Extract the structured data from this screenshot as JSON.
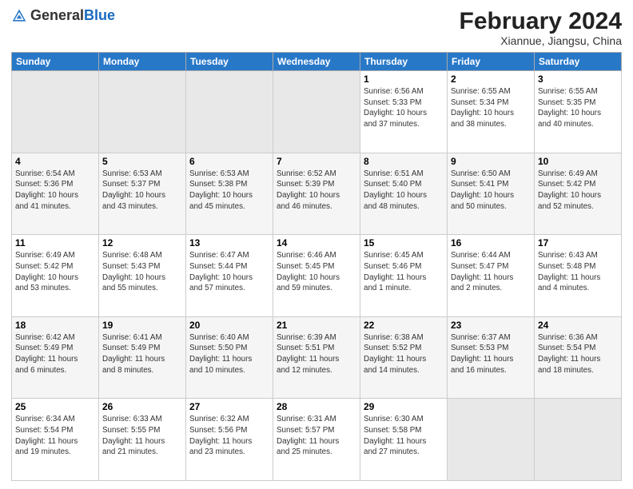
{
  "header": {
    "logo_general": "General",
    "logo_blue": "Blue",
    "month_year": "February 2024",
    "location": "Xiannue, Jiangsu, China"
  },
  "weekdays": [
    "Sunday",
    "Monday",
    "Tuesday",
    "Wednesday",
    "Thursday",
    "Friday",
    "Saturday"
  ],
  "weeks": [
    [
      {
        "day": "",
        "info": ""
      },
      {
        "day": "",
        "info": ""
      },
      {
        "day": "",
        "info": ""
      },
      {
        "day": "",
        "info": ""
      },
      {
        "day": "1",
        "info": "Sunrise: 6:56 AM\nSunset: 5:33 PM\nDaylight: 10 hours\nand 37 minutes."
      },
      {
        "day": "2",
        "info": "Sunrise: 6:55 AM\nSunset: 5:34 PM\nDaylight: 10 hours\nand 38 minutes."
      },
      {
        "day": "3",
        "info": "Sunrise: 6:55 AM\nSunset: 5:35 PM\nDaylight: 10 hours\nand 40 minutes."
      }
    ],
    [
      {
        "day": "4",
        "info": "Sunrise: 6:54 AM\nSunset: 5:36 PM\nDaylight: 10 hours\nand 41 minutes."
      },
      {
        "day": "5",
        "info": "Sunrise: 6:53 AM\nSunset: 5:37 PM\nDaylight: 10 hours\nand 43 minutes."
      },
      {
        "day": "6",
        "info": "Sunrise: 6:53 AM\nSunset: 5:38 PM\nDaylight: 10 hours\nand 45 minutes."
      },
      {
        "day": "7",
        "info": "Sunrise: 6:52 AM\nSunset: 5:39 PM\nDaylight: 10 hours\nand 46 minutes."
      },
      {
        "day": "8",
        "info": "Sunrise: 6:51 AM\nSunset: 5:40 PM\nDaylight: 10 hours\nand 48 minutes."
      },
      {
        "day": "9",
        "info": "Sunrise: 6:50 AM\nSunset: 5:41 PM\nDaylight: 10 hours\nand 50 minutes."
      },
      {
        "day": "10",
        "info": "Sunrise: 6:49 AM\nSunset: 5:42 PM\nDaylight: 10 hours\nand 52 minutes."
      }
    ],
    [
      {
        "day": "11",
        "info": "Sunrise: 6:49 AM\nSunset: 5:42 PM\nDaylight: 10 hours\nand 53 minutes."
      },
      {
        "day": "12",
        "info": "Sunrise: 6:48 AM\nSunset: 5:43 PM\nDaylight: 10 hours\nand 55 minutes."
      },
      {
        "day": "13",
        "info": "Sunrise: 6:47 AM\nSunset: 5:44 PM\nDaylight: 10 hours\nand 57 minutes."
      },
      {
        "day": "14",
        "info": "Sunrise: 6:46 AM\nSunset: 5:45 PM\nDaylight: 10 hours\nand 59 minutes."
      },
      {
        "day": "15",
        "info": "Sunrise: 6:45 AM\nSunset: 5:46 PM\nDaylight: 11 hours\nand 1 minute."
      },
      {
        "day": "16",
        "info": "Sunrise: 6:44 AM\nSunset: 5:47 PM\nDaylight: 11 hours\nand 2 minutes."
      },
      {
        "day": "17",
        "info": "Sunrise: 6:43 AM\nSunset: 5:48 PM\nDaylight: 11 hours\nand 4 minutes."
      }
    ],
    [
      {
        "day": "18",
        "info": "Sunrise: 6:42 AM\nSunset: 5:49 PM\nDaylight: 11 hours\nand 6 minutes."
      },
      {
        "day": "19",
        "info": "Sunrise: 6:41 AM\nSunset: 5:49 PM\nDaylight: 11 hours\nand 8 minutes."
      },
      {
        "day": "20",
        "info": "Sunrise: 6:40 AM\nSunset: 5:50 PM\nDaylight: 11 hours\nand 10 minutes."
      },
      {
        "day": "21",
        "info": "Sunrise: 6:39 AM\nSunset: 5:51 PM\nDaylight: 11 hours\nand 12 minutes."
      },
      {
        "day": "22",
        "info": "Sunrise: 6:38 AM\nSunset: 5:52 PM\nDaylight: 11 hours\nand 14 minutes."
      },
      {
        "day": "23",
        "info": "Sunrise: 6:37 AM\nSunset: 5:53 PM\nDaylight: 11 hours\nand 16 minutes."
      },
      {
        "day": "24",
        "info": "Sunrise: 6:36 AM\nSunset: 5:54 PM\nDaylight: 11 hours\nand 18 minutes."
      }
    ],
    [
      {
        "day": "25",
        "info": "Sunrise: 6:34 AM\nSunset: 5:54 PM\nDaylight: 11 hours\nand 19 minutes."
      },
      {
        "day": "26",
        "info": "Sunrise: 6:33 AM\nSunset: 5:55 PM\nDaylight: 11 hours\nand 21 minutes."
      },
      {
        "day": "27",
        "info": "Sunrise: 6:32 AM\nSunset: 5:56 PM\nDaylight: 11 hours\nand 23 minutes."
      },
      {
        "day": "28",
        "info": "Sunrise: 6:31 AM\nSunset: 5:57 PM\nDaylight: 11 hours\nand 25 minutes."
      },
      {
        "day": "29",
        "info": "Sunrise: 6:30 AM\nSunset: 5:58 PM\nDaylight: 11 hours\nand 27 minutes."
      },
      {
        "day": "",
        "info": ""
      },
      {
        "day": "",
        "info": ""
      }
    ]
  ]
}
